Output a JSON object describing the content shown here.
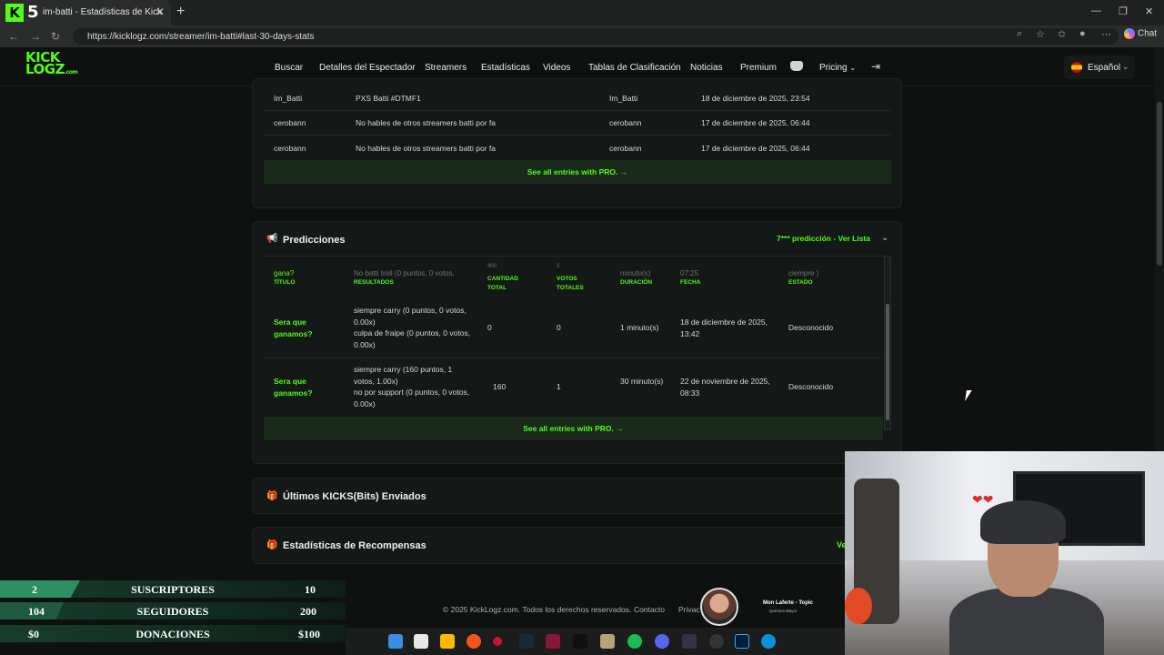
{
  "browser": {
    "tab_number": "5",
    "tab_title": "im-batti - Estadísticas de Kick",
    "url": "https://kicklogz.com/streamer/im-batti#last-30-days-stats",
    "chat_label": "Chat"
  },
  "header": {
    "logo_line1": "KICK",
    "logo_line2": "LOGZ",
    "logo_suffix": ".com",
    "nav": [
      "Buscar",
      "Detalles del Espectador",
      "Streamers",
      "Estadísticas",
      "Videos",
      "Tablas de Clasificación",
      "Noticias",
      "Premium"
    ],
    "pricing": "Pricing",
    "language": "Español"
  },
  "chat_messages": {
    "rows": [
      {
        "user": "Im_Batti",
        "message": "PXS Batti #DTMF1",
        "target": "Im_Batti",
        "date": "18 de diciembre de 2025, 23:54"
      },
      {
        "user": "cerobann",
        "message": "No hables de otros streamers batti por fa",
        "target": "cerobann",
        "date": "17 de diciembre de 2025, 06:44"
      },
      {
        "user": "cerobann",
        "message": "No hables de otros streamers batti por fa",
        "target": "cerobann",
        "date": "17 de diciembre de 2025, 06:44"
      }
    ],
    "see_all": "See all entries with PRO. →"
  },
  "predictions": {
    "title": "Predicciones",
    "link": "7*** predicción - Ver Lista",
    "columns": [
      "TÍTULO",
      "RESULTADOS",
      "CANTIDAD TOTAL",
      "VOTOS TOTALES",
      "DURACIÓN",
      "FECHA",
      "ESTADO"
    ],
    "faded_row": {
      "title": "gana?",
      "results": "No batti troll (0 puntos, 0 votos,",
      "amount": "400",
      "votes": "2",
      "duration": "minuto(s)",
      "date": "07:25",
      "status": "ciempre )"
    },
    "rows": [
      {
        "title": "Sera que ganamos?",
        "results": "siempre carry (0 puntos, 0 votos, 0.00x)\nculpa de fraipe (0 puntos, 0 votos, 0.00x)",
        "amount": "0",
        "votes": "0",
        "duration": "1 minuto(s)",
        "date": "18 de diciembre de 2025, 13:42",
        "status": "Desconocido"
      },
      {
        "title": "Sera que ganamos?",
        "results": "siempre carry (160 puntos, 1 votos, 1.00x)\nno por support (0 puntos, 0 votos, 0.00x)",
        "amount": "160",
        "votes": "1",
        "duration": "30 minuto(s)",
        "date": "22 de noviembre de 2025, 08:33",
        "status": "Desconocido"
      }
    ],
    "see_all": "See all entries with PRO. →"
  },
  "sections": {
    "kicks": "Últimos KICKS(Bits) Enviados",
    "rewards": "Estadísticas de Recompensas",
    "rewards_link": "Ve"
  },
  "footer": {
    "copyright": "© 2025 KickLogz.com. Todos los derechos reservados.",
    "contact": "Contacto",
    "privacy": "Privac"
  },
  "stream_overlay": [
    {
      "current": "2",
      "label": "SUSCRIPTORES",
      "goal": "10",
      "progress": 0.2
    },
    {
      "current": "104",
      "label": "SEGUIDORES",
      "goal": "200",
      "progress": 0.52
    },
    {
      "current": "$0",
      "label": "DONACIONES",
      "goal": "$100",
      "progress": 0
    }
  ],
  "now_playing": {
    "title": "Mon Laferte - Topic",
    "artist": "Química Mayor"
  },
  "colors": {
    "accent": "#53fc18",
    "background": "#0e1110",
    "card": "#141816"
  }
}
